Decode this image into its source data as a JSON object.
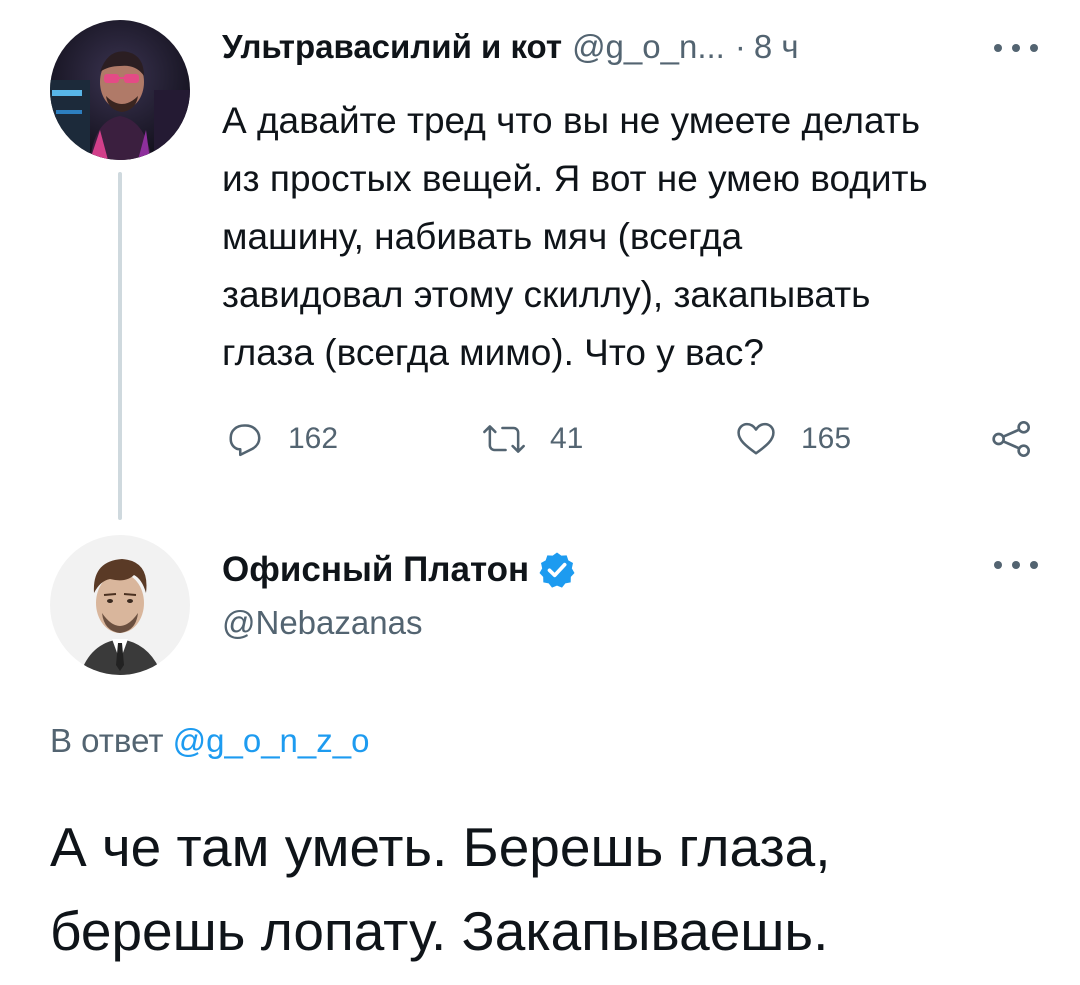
{
  "tweet1": {
    "display_name": "Ультравасилий и кот",
    "handle": "@g_o_n...",
    "separator": "·",
    "time": "8 ч",
    "text_lines": [
      "А давайте тред что вы не умеете делать",
      "из простых вещей. Я вот не умею водить",
      "машину, набивать мяч (всегда",
      "завидовал этому скиллу), закапывать",
      "глаза (всегда мимо). Что у вас?"
    ],
    "actions": {
      "replies": "162",
      "retweets": "41",
      "likes": "165"
    }
  },
  "tweet2": {
    "display_name": "Офисный Платон",
    "handle": "@Nebazanas",
    "verified": true,
    "reply_prefix": "В ответ",
    "reply_mention": "@g_o_n_z_o",
    "text_lines": [
      "А че там уметь. Берешь глаза,",
      "берешь лопату. Закапываешь."
    ]
  },
  "icons": {
    "reply": "reply-icon",
    "retweet": "retweet-icon",
    "like": "heart-icon",
    "share": "share-icon",
    "more": "more-icon",
    "verified": "verified-badge-icon"
  },
  "colors": {
    "text": "#0f1419",
    "secondary": "#536471",
    "link": "#1d9bf0",
    "thread_line": "#cfd9de"
  }
}
